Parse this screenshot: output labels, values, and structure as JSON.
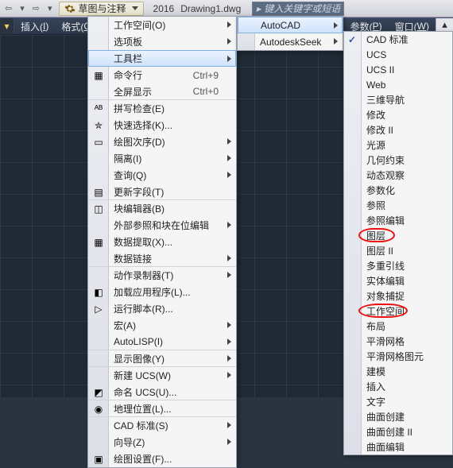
{
  "topbar": {
    "workspace_label": "草图与注释",
    "year": "2016",
    "filename": "Drawing1.dwg",
    "search_placeholder": "键入关键字或短语"
  },
  "menubar": {
    "left": [
      {
        "pre": "插入(",
        "hot": "I",
        "post": ")"
      },
      {
        "pre": "格式(",
        "hot": "O",
        "post": ")"
      }
    ],
    "right": [
      {
        "pre": "参数(",
        "hot": "P",
        "post": ")"
      },
      {
        "pre": "窗口(",
        "hot": "W",
        "post": ")"
      }
    ]
  },
  "menu1": [
    {
      "label": "工作空间(O)",
      "icon": "",
      "submenu": true
    },
    {
      "label": "选项板",
      "icon": "",
      "submenu": true
    },
    {
      "label": "工具栏",
      "icon": "",
      "submenu": true,
      "hover": true
    },
    {
      "label": "命令行",
      "icon": "cmd",
      "shortcut": "Ctrl+9"
    },
    {
      "label": "全屏显示",
      "icon": "",
      "shortcut": "Ctrl+0",
      "groupend": true
    },
    {
      "label": "拼写检查(E)",
      "icon": "abc"
    },
    {
      "label": "快速选择(K)...",
      "icon": "qsel"
    },
    {
      "label": "绘图次序(D)",
      "icon": "order",
      "submenu": true
    },
    {
      "label": "隔离(I)",
      "icon": "",
      "submenu": true
    },
    {
      "label": "查询(Q)",
      "icon": "",
      "submenu": true
    },
    {
      "label": "更新字段(T)",
      "icon": "field",
      "groupend": true
    },
    {
      "label": "块编辑器(B)",
      "icon": "block"
    },
    {
      "label": "外部参照和块在位编辑",
      "icon": "",
      "submenu": true
    },
    {
      "label": "数据提取(X)...",
      "icon": "data"
    },
    {
      "label": "数据链接",
      "icon": "",
      "submenu": true,
      "groupend": true
    },
    {
      "label": "动作录制器(T)",
      "icon": "",
      "submenu": true
    },
    {
      "label": "加载应用程序(L)...",
      "icon": "load"
    },
    {
      "label": "运行脚本(R)...",
      "icon": "script"
    },
    {
      "label": "宏(A)",
      "icon": "",
      "submenu": true
    },
    {
      "label": "AutoLISP(I)",
      "icon": "",
      "submenu": true,
      "groupend": true
    },
    {
      "label": "显示图像(Y)",
      "icon": "",
      "submenu": true,
      "groupend": true
    },
    {
      "label": "新建 UCS(W)",
      "icon": "",
      "submenu": true
    },
    {
      "label": "命名 UCS(U)...",
      "icon": "ucs",
      "groupend": true
    },
    {
      "label": "地理位置(L)...",
      "icon": "geo",
      "groupend": true
    },
    {
      "label": "CAD 标准(S)",
      "icon": "",
      "submenu": true
    },
    {
      "label": "向导(Z)",
      "icon": "",
      "submenu": true
    },
    {
      "label": "绘图设置(F)...",
      "icon": "dset"
    }
  ],
  "menu2": [
    {
      "label": "AutoCAD",
      "submenu": true,
      "hover": true
    },
    {
      "label": "AutodeskSeek",
      "submenu": true
    }
  ],
  "menu3": [
    {
      "label": "CAD 标准",
      "checked": true
    },
    {
      "label": "UCS"
    },
    {
      "label": "UCS II"
    },
    {
      "label": "Web"
    },
    {
      "label": "三维导航"
    },
    {
      "label": "修改"
    },
    {
      "label": "修改 II"
    },
    {
      "label": "光源"
    },
    {
      "label": "几何约束"
    },
    {
      "label": "动态观察"
    },
    {
      "label": "参数化"
    },
    {
      "label": "参照"
    },
    {
      "label": "参照编辑"
    },
    {
      "label": "图层",
      "circle": "rc1"
    },
    {
      "label": "图层 II"
    },
    {
      "label": "多重引线"
    },
    {
      "label": "实体编辑"
    },
    {
      "label": "对象捕捉"
    },
    {
      "label": "工作空间",
      "circle": "rc2"
    },
    {
      "label": "布局"
    },
    {
      "label": "平滑网格"
    },
    {
      "label": "平滑网格图元"
    },
    {
      "label": "建模"
    },
    {
      "label": "插入"
    },
    {
      "label": "文字"
    },
    {
      "label": "曲面创建"
    },
    {
      "label": "曲面创建 II"
    },
    {
      "label": "曲面编辑"
    }
  ],
  "icons": {
    "cmd": "▦",
    "abc": "ᴬᴮ",
    "qsel": "✮",
    "order": "▭",
    "field": "▤",
    "block": "◫",
    "data": "▦",
    "load": "◧",
    "script": "▷",
    "ucs": "◩",
    "geo": "◉",
    "dset": "▣"
  }
}
